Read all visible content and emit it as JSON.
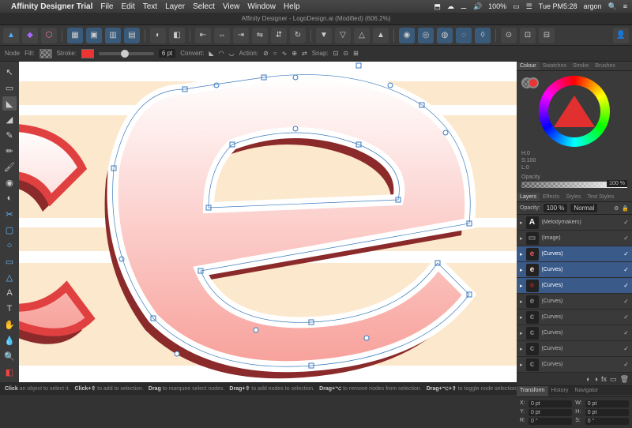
{
  "menubar": {
    "app": "Affinity Designer Trial",
    "items": [
      "File",
      "Edit",
      "Text",
      "Layer",
      "Select",
      "View",
      "Window",
      "Help"
    ],
    "time": "Tue PM5:28",
    "user": "argon",
    "battery": "100%"
  },
  "tabbar": {
    "title": "Affinity Designer - LogoDesign.ai (Modified) (606.2%)"
  },
  "contextbar": {
    "mode": "Node",
    "fill": "Fill:",
    "stroke": "Stroke:",
    "strokewidth": "6 pt",
    "convert": "Convert:",
    "action": "Action:",
    "snap": "Snap:"
  },
  "panels": {
    "colour_tabs": [
      "Colour",
      "Swatches",
      "Stroke",
      "Brushes"
    ],
    "hsl": {
      "h": "H:0",
      "s": "S:100",
      "l": "L:0"
    },
    "opacity_label": "Opacity",
    "opacity_value": "100 %",
    "layers_tabs": [
      "Layers",
      "Effects",
      "Styles",
      "Text Styles"
    ],
    "layer_opacity_label": "Opacity:",
    "layer_opacity_value": "100 %",
    "blend": "Normal",
    "layers": [
      {
        "thumb": "A",
        "name": "(Melodymakers)",
        "sel": false,
        "thc": "#fff"
      },
      {
        "thumb": "▭",
        "name": "(Image)",
        "sel": false,
        "thc": "#888"
      },
      {
        "thumb": "e",
        "name": "(Curves)",
        "sel": true,
        "thc": "#e55"
      },
      {
        "thumb": "e",
        "name": "(Curves)",
        "sel": true,
        "thc": "#fdd"
      },
      {
        "thumb": "e",
        "name": "(Curves)",
        "sel": true,
        "thc": "#922"
      },
      {
        "thumb": "e",
        "name": "(Curves)",
        "sel": false,
        "thc": "#888"
      },
      {
        "thumb": "c",
        "name": "(Curves)",
        "sel": false,
        "thc": "#888"
      },
      {
        "thumb": "c",
        "name": "(Curves)",
        "sel": false,
        "thc": "#888"
      },
      {
        "thumb": "c",
        "name": "(Curves)",
        "sel": false,
        "thc": "#888"
      },
      {
        "thumb": "c",
        "name": "(Curves)",
        "sel": false,
        "thc": "#888"
      }
    ],
    "transform_tabs": [
      "Transform",
      "History",
      "Navigator"
    ],
    "transform": {
      "xl": "X:",
      "x": "0 pt",
      "wl": "W:",
      "w": "0 pt",
      "yl": "Y:",
      "y": "0 pt",
      "hl": "H:",
      "h": "0 pt",
      "rl": "R:",
      "r": "0 °",
      "sl": "S:",
      "s": "0 °"
    }
  },
  "statusbar": {
    "hints": [
      "Click an object to select it.",
      "Click+⇧ to add to selection.",
      "Drag to marquee select nodes.",
      "Drag+⇧ to add nodes to selection.",
      "Drag+⌥ to remove nodes from selection.",
      "Drag+⌥+⇧ to toggle node selection."
    ]
  }
}
